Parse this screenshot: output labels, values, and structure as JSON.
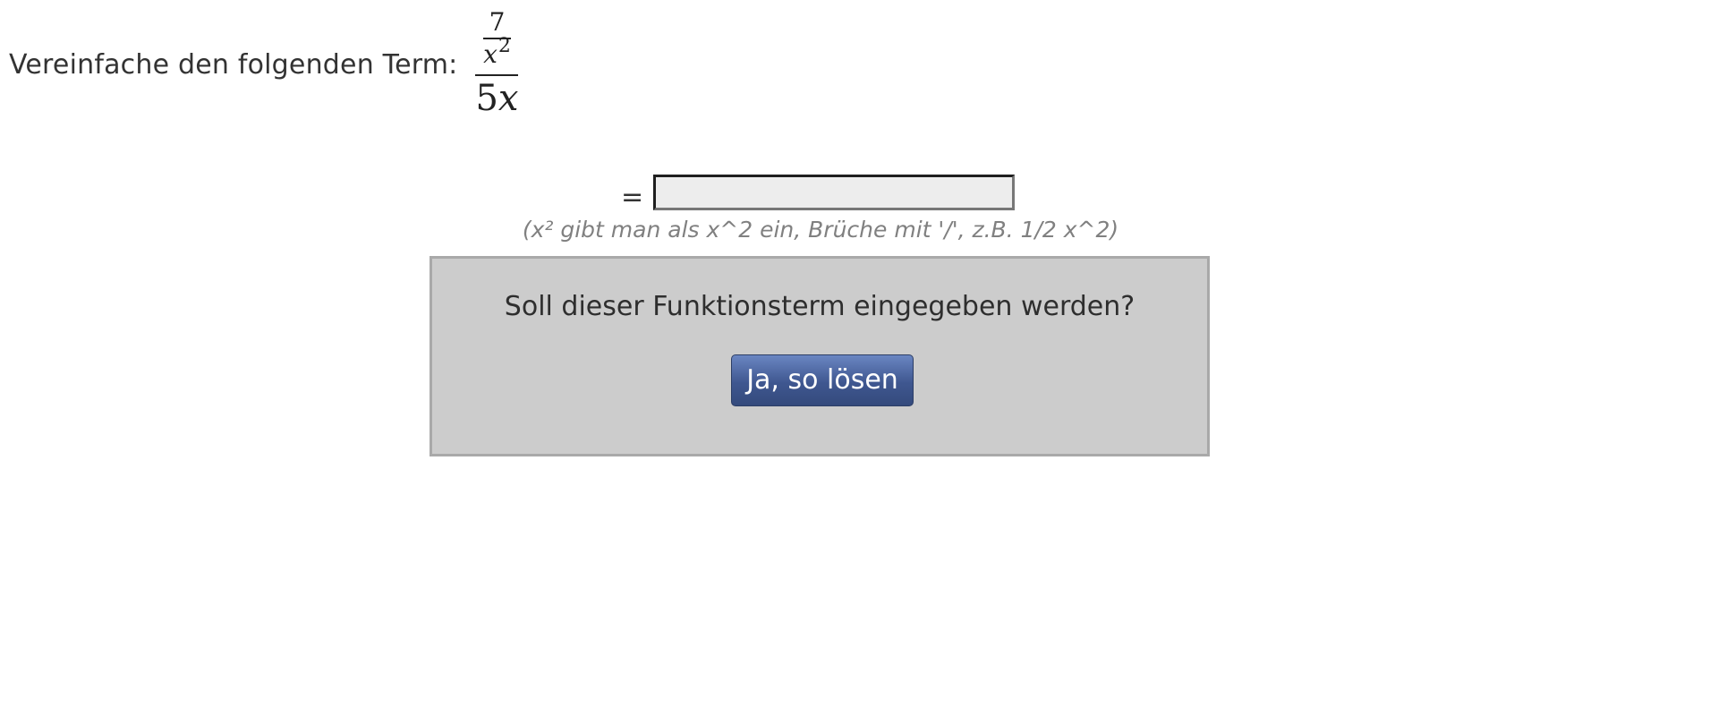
{
  "task": {
    "label": "Vereinfache den folgenden Term:",
    "term": {
      "inner_numerator": "7",
      "inner_denominator_var": "x",
      "inner_denominator_exp": "2",
      "outer_denominator_coef": "5",
      "outer_denominator_var": "x"
    }
  },
  "answer": {
    "equals": "=",
    "value": "",
    "placeholder": ""
  },
  "hint": "(x² gibt man als x^2 ein, Brüche mit '/', z.B. 1/2 x^2)",
  "confirm": {
    "question": "Soll dieser Funktionsterm eingegeben werden?",
    "button_label": "Ja, so lösen"
  },
  "colors": {
    "button_top": "#6a86c2",
    "button_bottom": "#344a7c",
    "box_background": "#cccccc",
    "hint_text": "#808080"
  }
}
